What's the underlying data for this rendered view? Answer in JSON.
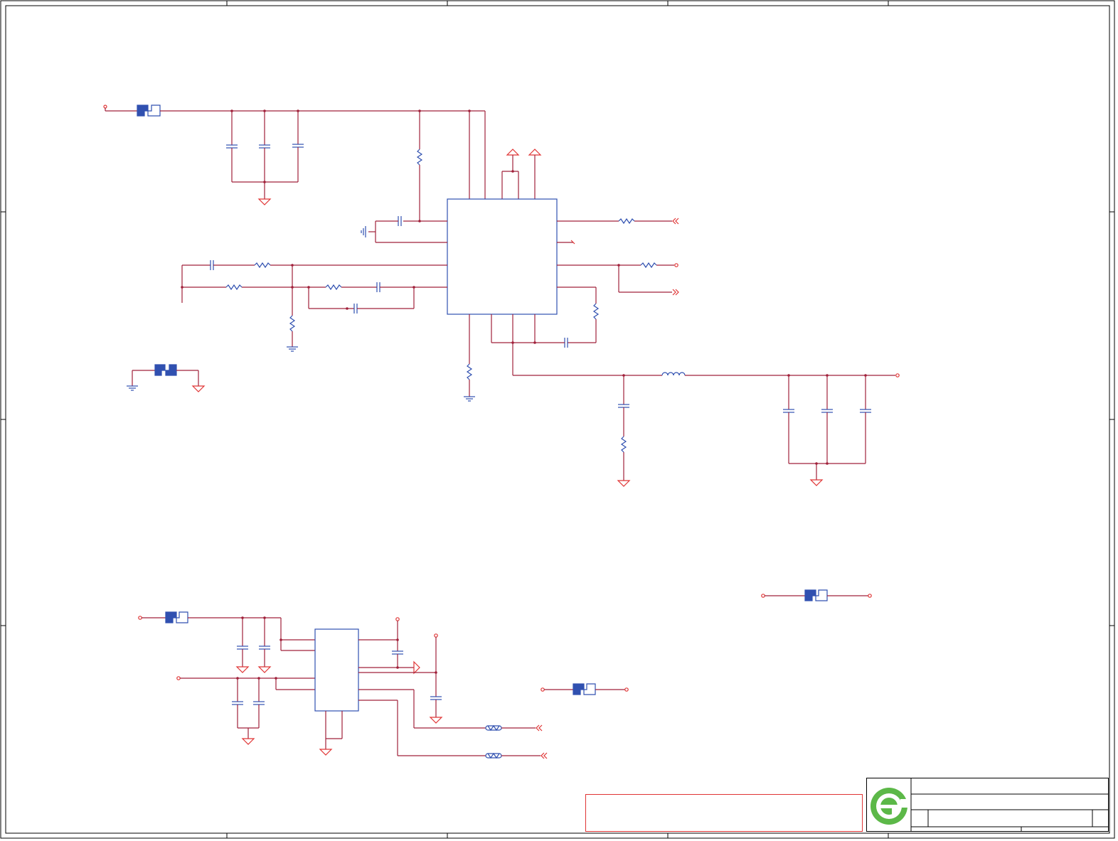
{
  "colors": {
    "wire": "#a0203a",
    "pin": "#e03434",
    "part_outline": "#3050b0",
    "frame": "#000000",
    "logo_green": "#5cb848"
  },
  "logo": {
    "icon": "green-e-logo-icon"
  },
  "notice_box": {
    "text": ""
  },
  "title_block": {
    "title": "",
    "document_number": "",
    "revision": "",
    "sheet": ""
  }
}
